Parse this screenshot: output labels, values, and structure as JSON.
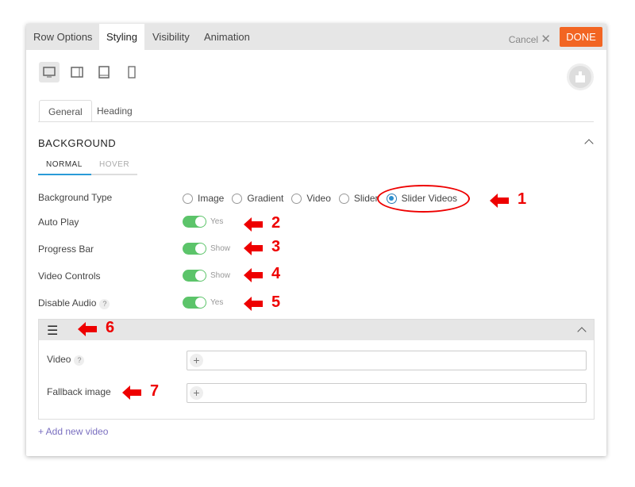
{
  "header": {
    "tabs": [
      "Row Options",
      "Styling",
      "Visibility",
      "Animation"
    ],
    "active_tab": "Styling",
    "cancel_label": "Cancel",
    "done_label": "DONE",
    "done_color": "#f26522"
  },
  "devices": [
    {
      "icon": "desktop-icon",
      "active": true
    },
    {
      "icon": "tablet-landscape-icon"
    },
    {
      "icon": "tablet-icon"
    },
    {
      "icon": "mobile-icon"
    }
  ],
  "subtabs": [
    "General",
    "Heading"
  ],
  "background": {
    "title": "BACKGROUND",
    "states": [
      "NORMAL",
      "HOVER"
    ],
    "type_label": "Background Type",
    "type_options": [
      "Image",
      "Gradient",
      "Video",
      "Slider",
      "Slider Videos"
    ],
    "selected_type": "Slider Videos",
    "settings": [
      {
        "label": "Auto Play",
        "value": "Yes",
        "on": true
      },
      {
        "label": "Progress Bar",
        "value": "Show",
        "on": true
      },
      {
        "label": "Video Controls",
        "value": "Show",
        "on": true
      },
      {
        "label": "Disable Audio",
        "value": "Yes",
        "on": true,
        "help": "?"
      }
    ],
    "video_item": {
      "video_label": "Video",
      "video_help": "?",
      "fallback_label": "Fallback image",
      "add_symbol": "+"
    },
    "add_new": "+ Add new video"
  },
  "annotations": [
    "1",
    "2",
    "3",
    "4",
    "5",
    "6",
    "7"
  ],
  "toggle_color": "#5cc46a"
}
